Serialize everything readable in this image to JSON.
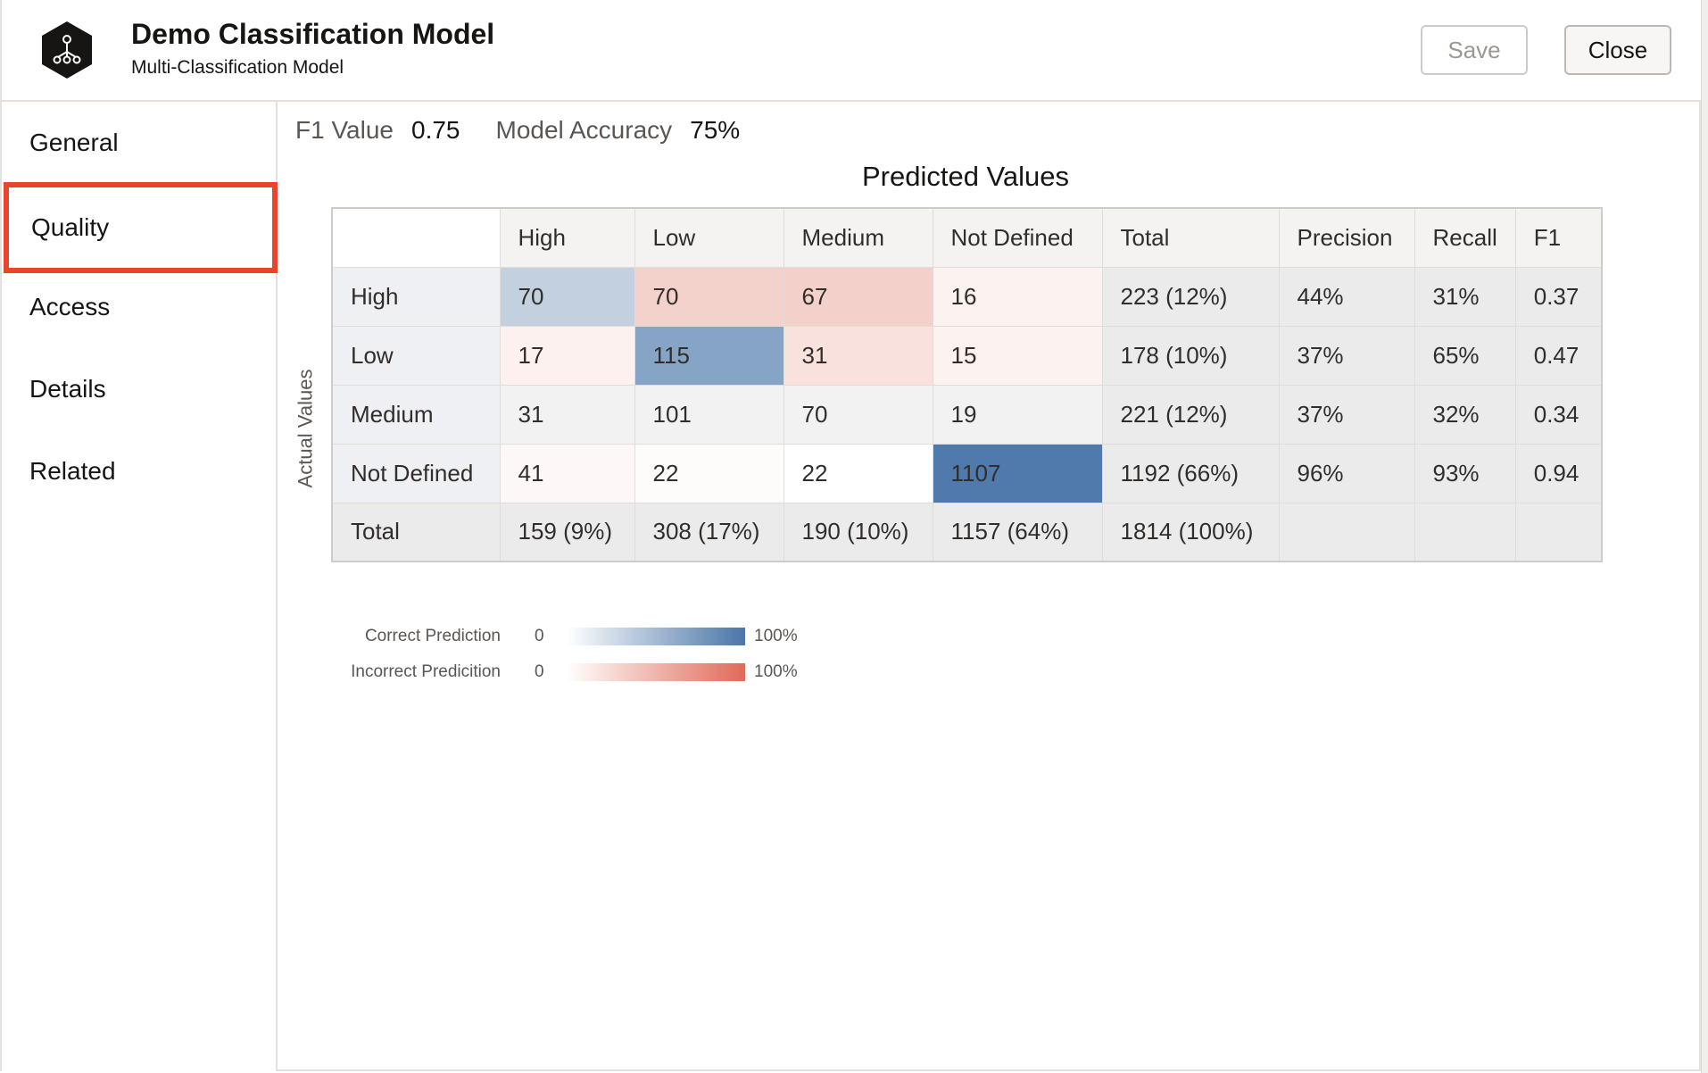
{
  "header": {
    "title": "Demo Classification Model",
    "subtitle": "Multi-Classification Model",
    "save_label": "Save",
    "close_label": "Close",
    "logo_icon": "model-network-icon"
  },
  "sidebar": {
    "items": [
      {
        "label": "General"
      },
      {
        "label": "Quality",
        "active": true
      },
      {
        "label": "Access"
      },
      {
        "label": "Details"
      },
      {
        "label": "Related"
      }
    ]
  },
  "metrics": {
    "f1_label": "F1 Value",
    "f1_value": "0.75",
    "accuracy_label": "Model Accuracy",
    "accuracy_value": "75%"
  },
  "matrix": {
    "title": "Predicted Values",
    "row_axis_label": "Actual Values",
    "columns": [
      "High",
      "Low",
      "Medium",
      "Not Defined",
      "Total",
      "Precision",
      "Recall",
      "F1"
    ],
    "rows": [
      {
        "label": "High",
        "cells": [
          "70",
          "70",
          "67",
          "16"
        ],
        "total": "223 (12%)",
        "precision": "44%",
        "recall": "31%",
        "f1": "0.37"
      },
      {
        "label": "Low",
        "cells": [
          "17",
          "115",
          "31",
          "15"
        ],
        "total": "178 (10%)",
        "precision": "37%",
        "recall": "65%",
        "f1": "0.47"
      },
      {
        "label": "Medium",
        "cells": [
          "31",
          "101",
          "70",
          "19"
        ],
        "total": "221 (12%)",
        "precision": "37%",
        "recall": "32%",
        "f1": "0.34"
      },
      {
        "label": "Not Defined",
        "cells": [
          "41",
          "22",
          "22",
          "1107"
        ],
        "total": "1192 (66%)",
        "precision": "96%",
        "recall": "93%",
        "f1": "0.94"
      }
    ],
    "total_row": {
      "label": "Total",
      "cells": [
        "159 (9%)",
        "308 (17%)",
        "190 (10%)",
        "1157 (64%)"
      ],
      "total": "1814 (100%)"
    },
    "cell_colors": [
      [
        "#c3d0df",
        "#f4d2cc",
        "#f4d0ca",
        "#fcf3f1"
      ],
      [
        "#fcf1ef",
        "#86a5c6",
        "#f9e2de",
        "#fcf3f1"
      ],
      [
        "#f2f2f2",
        "#f2f2f2",
        "#f2f2f2",
        "#f2f2f2"
      ],
      [
        "#fdf8f7",
        "#fefcfb",
        "#ffffff",
        "#4f7aab"
      ]
    ]
  },
  "legend": {
    "correct_label": "Correct Prediction",
    "incorrect_label": "Incorrect Predicition",
    "min_label": "0",
    "max_label": "100%",
    "correct_color": "#4a76a8",
    "incorrect_color": "#e06a58"
  }
}
